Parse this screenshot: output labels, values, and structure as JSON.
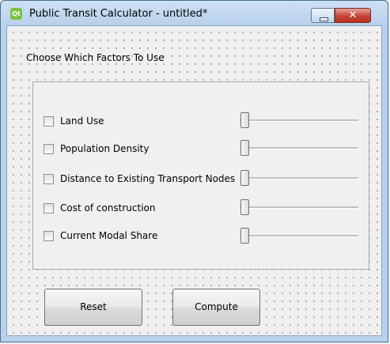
{
  "window": {
    "title": "Public Transit Calculator - untitled*",
    "icon_text": "Qt",
    "close_glyph": "✕"
  },
  "heading": "Choose Which Factors To Use",
  "factors": [
    {
      "label": "Land Use",
      "checked": false,
      "slider_value": 0
    },
    {
      "label": "Population Density",
      "checked": false,
      "slider_value": 0
    },
    {
      "label": "Distance to Existing Transport Nodes",
      "checked": false,
      "slider_value": 0
    },
    {
      "label": "Cost of construction",
      "checked": false,
      "slider_value": 0
    },
    {
      "label": "Current Modal Share",
      "checked": false,
      "slider_value": 0
    }
  ],
  "buttons": {
    "reset": "Reset",
    "compute": "Compute"
  }
}
